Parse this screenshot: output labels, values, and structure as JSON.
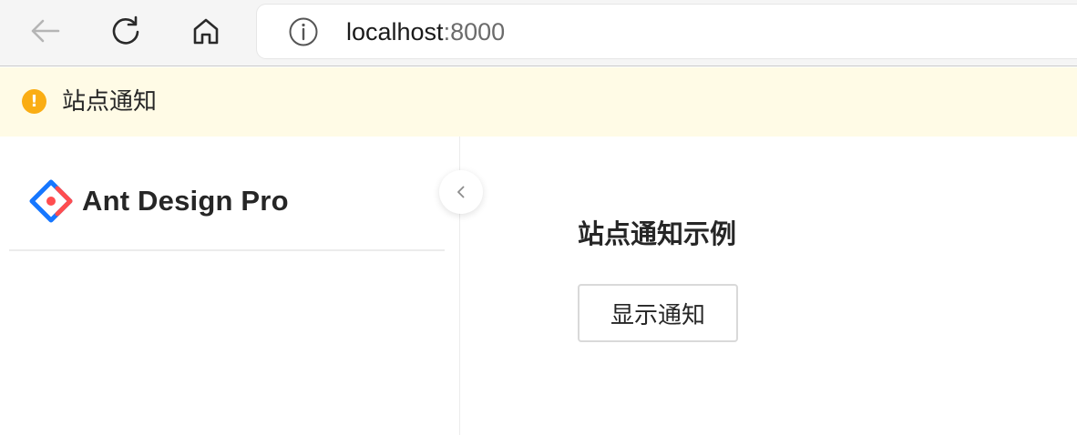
{
  "browser": {
    "url_host": "localhost",
    "url_port": ":8000",
    "icons": [
      "back-arrow-icon",
      "reload-icon",
      "home-icon",
      "info-icon"
    ]
  },
  "banner": {
    "text": "站点通知",
    "icon": "warning-circle-icon",
    "color": "#faad14",
    "background": "#fffbe6"
  },
  "sidebar": {
    "brand": "Ant Design Pro",
    "logo_icon": "ant-design-logo",
    "collapse_icon": "chevron-left-icon"
  },
  "main": {
    "title": "站点通知示例",
    "show_button_label": "显示通知"
  }
}
